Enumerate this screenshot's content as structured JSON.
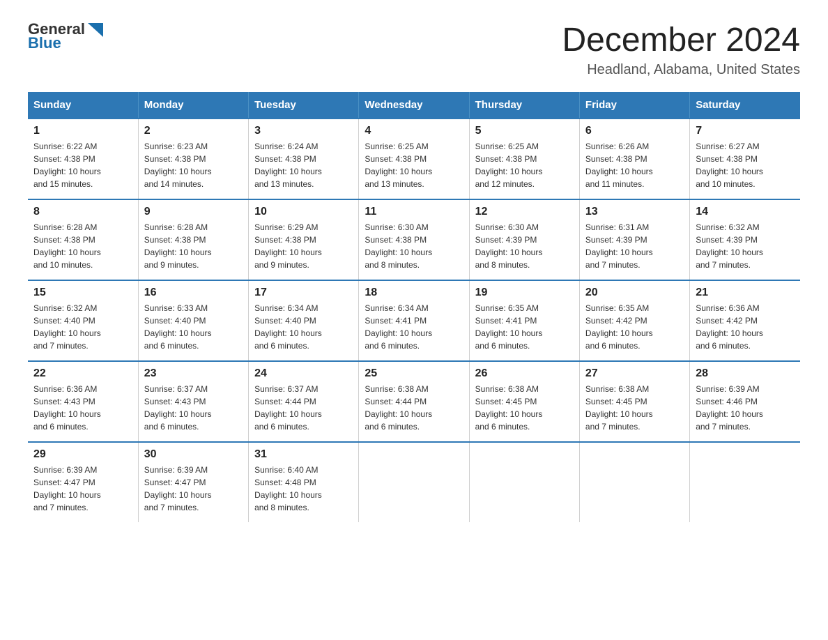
{
  "logo": {
    "text_general": "General",
    "text_blue": "Blue"
  },
  "title": "December 2024",
  "subtitle": "Headland, Alabama, United States",
  "weekdays": [
    "Sunday",
    "Monday",
    "Tuesday",
    "Wednesday",
    "Thursday",
    "Friday",
    "Saturday"
  ],
  "weeks": [
    [
      {
        "day": "1",
        "info": "Sunrise: 6:22 AM\nSunset: 4:38 PM\nDaylight: 10 hours\nand 15 minutes."
      },
      {
        "day": "2",
        "info": "Sunrise: 6:23 AM\nSunset: 4:38 PM\nDaylight: 10 hours\nand 14 minutes."
      },
      {
        "day": "3",
        "info": "Sunrise: 6:24 AM\nSunset: 4:38 PM\nDaylight: 10 hours\nand 13 minutes."
      },
      {
        "day": "4",
        "info": "Sunrise: 6:25 AM\nSunset: 4:38 PM\nDaylight: 10 hours\nand 13 minutes."
      },
      {
        "day": "5",
        "info": "Sunrise: 6:25 AM\nSunset: 4:38 PM\nDaylight: 10 hours\nand 12 minutes."
      },
      {
        "day": "6",
        "info": "Sunrise: 6:26 AM\nSunset: 4:38 PM\nDaylight: 10 hours\nand 11 minutes."
      },
      {
        "day": "7",
        "info": "Sunrise: 6:27 AM\nSunset: 4:38 PM\nDaylight: 10 hours\nand 10 minutes."
      }
    ],
    [
      {
        "day": "8",
        "info": "Sunrise: 6:28 AM\nSunset: 4:38 PM\nDaylight: 10 hours\nand 10 minutes."
      },
      {
        "day": "9",
        "info": "Sunrise: 6:28 AM\nSunset: 4:38 PM\nDaylight: 10 hours\nand 9 minutes."
      },
      {
        "day": "10",
        "info": "Sunrise: 6:29 AM\nSunset: 4:38 PM\nDaylight: 10 hours\nand 9 minutes."
      },
      {
        "day": "11",
        "info": "Sunrise: 6:30 AM\nSunset: 4:38 PM\nDaylight: 10 hours\nand 8 minutes."
      },
      {
        "day": "12",
        "info": "Sunrise: 6:30 AM\nSunset: 4:39 PM\nDaylight: 10 hours\nand 8 minutes."
      },
      {
        "day": "13",
        "info": "Sunrise: 6:31 AM\nSunset: 4:39 PM\nDaylight: 10 hours\nand 7 minutes."
      },
      {
        "day": "14",
        "info": "Sunrise: 6:32 AM\nSunset: 4:39 PM\nDaylight: 10 hours\nand 7 minutes."
      }
    ],
    [
      {
        "day": "15",
        "info": "Sunrise: 6:32 AM\nSunset: 4:40 PM\nDaylight: 10 hours\nand 7 minutes."
      },
      {
        "day": "16",
        "info": "Sunrise: 6:33 AM\nSunset: 4:40 PM\nDaylight: 10 hours\nand 6 minutes."
      },
      {
        "day": "17",
        "info": "Sunrise: 6:34 AM\nSunset: 4:40 PM\nDaylight: 10 hours\nand 6 minutes."
      },
      {
        "day": "18",
        "info": "Sunrise: 6:34 AM\nSunset: 4:41 PM\nDaylight: 10 hours\nand 6 minutes."
      },
      {
        "day": "19",
        "info": "Sunrise: 6:35 AM\nSunset: 4:41 PM\nDaylight: 10 hours\nand 6 minutes."
      },
      {
        "day": "20",
        "info": "Sunrise: 6:35 AM\nSunset: 4:42 PM\nDaylight: 10 hours\nand 6 minutes."
      },
      {
        "day": "21",
        "info": "Sunrise: 6:36 AM\nSunset: 4:42 PM\nDaylight: 10 hours\nand 6 minutes."
      }
    ],
    [
      {
        "day": "22",
        "info": "Sunrise: 6:36 AM\nSunset: 4:43 PM\nDaylight: 10 hours\nand 6 minutes."
      },
      {
        "day": "23",
        "info": "Sunrise: 6:37 AM\nSunset: 4:43 PM\nDaylight: 10 hours\nand 6 minutes."
      },
      {
        "day": "24",
        "info": "Sunrise: 6:37 AM\nSunset: 4:44 PM\nDaylight: 10 hours\nand 6 minutes."
      },
      {
        "day": "25",
        "info": "Sunrise: 6:38 AM\nSunset: 4:44 PM\nDaylight: 10 hours\nand 6 minutes."
      },
      {
        "day": "26",
        "info": "Sunrise: 6:38 AM\nSunset: 4:45 PM\nDaylight: 10 hours\nand 6 minutes."
      },
      {
        "day": "27",
        "info": "Sunrise: 6:38 AM\nSunset: 4:45 PM\nDaylight: 10 hours\nand 7 minutes."
      },
      {
        "day": "28",
        "info": "Sunrise: 6:39 AM\nSunset: 4:46 PM\nDaylight: 10 hours\nand 7 minutes."
      }
    ],
    [
      {
        "day": "29",
        "info": "Sunrise: 6:39 AM\nSunset: 4:47 PM\nDaylight: 10 hours\nand 7 minutes."
      },
      {
        "day": "30",
        "info": "Sunrise: 6:39 AM\nSunset: 4:47 PM\nDaylight: 10 hours\nand 7 minutes."
      },
      {
        "day": "31",
        "info": "Sunrise: 6:40 AM\nSunset: 4:48 PM\nDaylight: 10 hours\nand 8 minutes."
      },
      {
        "day": "",
        "info": ""
      },
      {
        "day": "",
        "info": ""
      },
      {
        "day": "",
        "info": ""
      },
      {
        "day": "",
        "info": ""
      }
    ]
  ]
}
